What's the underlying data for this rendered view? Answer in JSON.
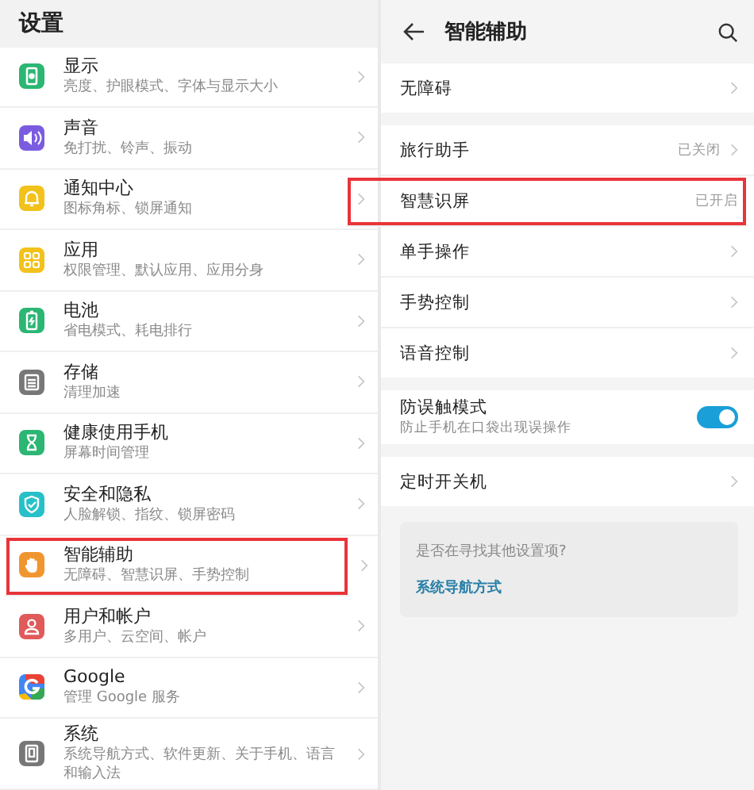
{
  "settings": {
    "title": "设置",
    "items": [
      {
        "title": "显示",
        "subtitle": "亮度、护眼模式、字体与显示大小",
        "color": "#2bb673",
        "highlighted": false
      },
      {
        "title": "声音",
        "subtitle": "免打扰、铃声、振动",
        "color": "#7b5ce0",
        "highlighted": false
      },
      {
        "title": "通知中心",
        "subtitle": "图标角标、锁屏通知",
        "color": "#f2c21b",
        "highlighted": false
      },
      {
        "title": "应用",
        "subtitle": "权限管理、默认应用、应用分身",
        "color": "#f2c21b",
        "highlighted": false
      },
      {
        "title": "电池",
        "subtitle": "省电模式、耗电排行",
        "color": "#2bb673",
        "highlighted": false
      },
      {
        "title": "存储",
        "subtitle": "清理加速",
        "color": "#777777",
        "highlighted": false
      },
      {
        "title": "健康使用手机",
        "subtitle": "屏幕时间管理",
        "color": "#2bb673",
        "highlighted": false
      },
      {
        "title": "安全和隐私",
        "subtitle": "人脸解锁、指纹、锁屏密码",
        "color": "#27c0c8",
        "highlighted": false
      },
      {
        "title": "智能辅助",
        "subtitle": "无障碍、智慧识屏、手势控制",
        "color": "#f0962e",
        "highlighted": true
      },
      {
        "title": "用户和帐户",
        "subtitle": "多用户、云空间、帐户",
        "color": "#e05a5a",
        "highlighted": false
      },
      {
        "title": "Google",
        "subtitle": "管理 Google 服务",
        "color": "#4285f4",
        "highlighted": false
      },
      {
        "title": "系统",
        "subtitle": "系统导航方式、软件更新、关于手机、语言和输入法",
        "color": "#777777",
        "highlighted": false
      }
    ]
  },
  "assist": {
    "title": "智能辅助",
    "groups": [
      [
        {
          "kind": "link",
          "title": "无障碍",
          "highlighted": false
        }
      ],
      [
        {
          "kind": "link",
          "title": "旅行助手",
          "status": "已关闭",
          "highlighted": false
        },
        {
          "kind": "status",
          "title": "智慧识屏",
          "status": "已开启",
          "highlighted": true
        },
        {
          "kind": "link",
          "title": "单手操作",
          "highlighted": false
        },
        {
          "kind": "link",
          "title": "手势控制",
          "highlighted": false
        },
        {
          "kind": "link",
          "title": "语音控制",
          "highlighted": false
        }
      ],
      [
        {
          "kind": "toggle",
          "title": "防误触模式",
          "subtitle": "防止手机在口袋出现误操作",
          "on": true,
          "highlighted": false
        }
      ],
      [
        {
          "kind": "link",
          "title": "定时开关机",
          "highlighted": false
        }
      ]
    ],
    "suggestion": {
      "question": "是否在寻找其他设置项?",
      "link": "系统导航方式"
    }
  }
}
